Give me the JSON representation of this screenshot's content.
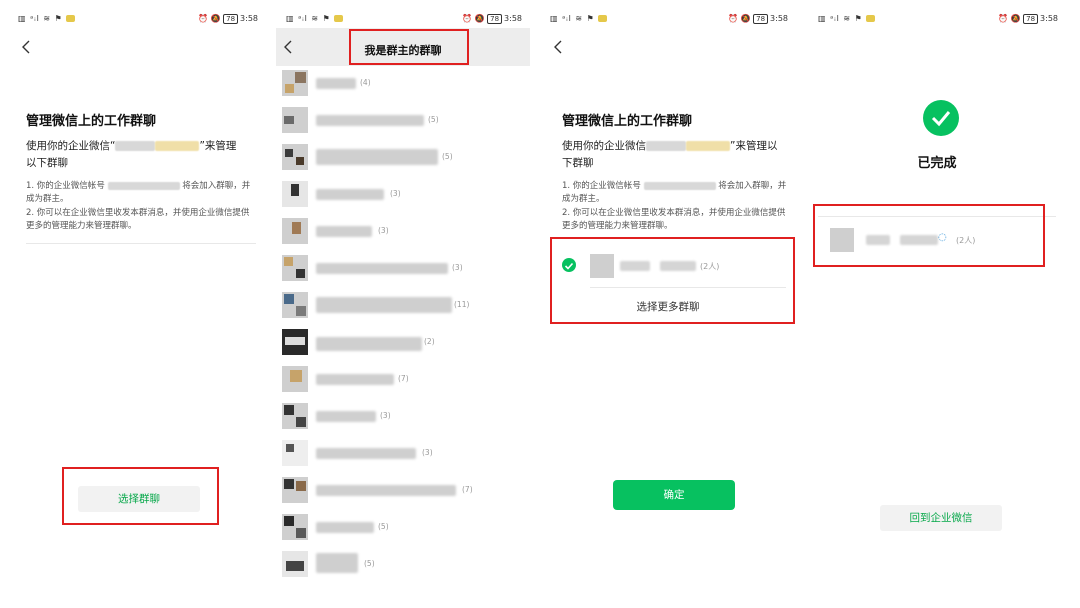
{
  "status": {
    "time": "3:58",
    "battery": "78"
  },
  "panel1": {
    "title": "管理微信上的工作群聊",
    "desc_prefix": "使用你的企业微信“",
    "desc_suffix": "”来管理以下群聊",
    "item1": "1.  你的企业微信帐号",
    "item1_suffix": "将会加入群聊，并成为群主。",
    "item2": "2.  你可以在企业微信里收发本群消息，并使用企业微信提供更多的管理能力来管理群聊。",
    "button": "选择群聊"
  },
  "panel2": {
    "title": "我是群主的群聊",
    "groups": [
      {
        "count": "(4)"
      },
      {
        "count": "(5)"
      },
      {
        "count": "(5)"
      },
      {
        "count": "(3)"
      },
      {
        "count": "(3)"
      },
      {
        "count": "(3)"
      },
      {
        "count": "(11)"
      },
      {
        "count": "(2)"
      },
      {
        "count": "(7)"
      },
      {
        "count": "(3)"
      },
      {
        "count": "(3)"
      },
      {
        "count": "(7)"
      },
      {
        "count": "(5)"
      },
      {
        "count": "(5)"
      }
    ]
  },
  "panel3": {
    "title": "管理微信上的工作群聊",
    "desc_prefix": "使用你的企业微信",
    "desc_suffix": "”来管理以下群聊",
    "item1": "1.  你的企业微信帐号",
    "item1_suffix": "将会加入群聊，并成为群主。",
    "item2": "2.  你可以在企业微信里收发本群消息，并使用企业微信提供更多的管理能力来管理群聊。",
    "selected_count": "(2人)",
    "more": "选择更多群聊",
    "confirm": "确定"
  },
  "panel4": {
    "done": "已完成",
    "group_count": "(2人)",
    "back_button": "回到企业微信"
  },
  "colors": {
    "accent": "#07c160",
    "highlight": "#e02020"
  }
}
